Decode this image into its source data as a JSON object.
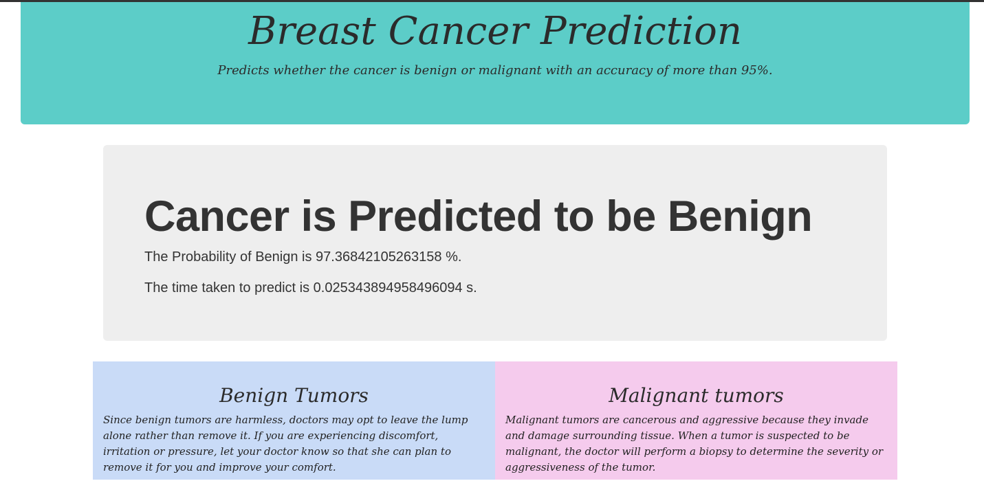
{
  "header": {
    "title": "Breast Cancer Prediction",
    "subtitle": "Predicts whether the cancer is benign or malignant with an accuracy of more than 95%."
  },
  "result": {
    "heading": "Cancer is Predicted to be Benign",
    "probability_text": "The Probability of Benign is 97.36842105263158 %.",
    "time_text": "The time taken to predict is 0.025343894958496094 s."
  },
  "cards": {
    "benign": {
      "title": "Benign Tumors",
      "text": "Since benign tumors are harmless, doctors may opt to leave the lump alone rather than remove it. If you are experiencing discomfort, irritation or pressure, let your doctor know so that she can plan to remove it for you and improve your comfort."
    },
    "malignant": {
      "title": "Malignant tumors",
      "text": "Malignant tumors are cancerous and aggressive because they invade and damage surrounding tissue. When a tumor is suspected to be malignant, the doctor will perform a biopsy to determine the severity or aggressiveness of the tumor."
    }
  },
  "colors": {
    "header_bg": "#5ccdc8",
    "result_bg": "#eeeeee",
    "benign_bg": "#c9dbf7",
    "malignant_bg": "#f5cbed"
  }
}
